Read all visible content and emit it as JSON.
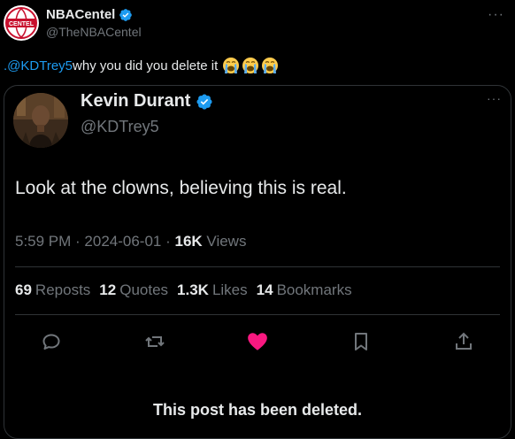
{
  "outer_tweet": {
    "author_name": "NBACentel",
    "author_handle": "@TheNBACentel",
    "avatar_text": "CENTEL",
    "mention": ".@KDTrey5",
    "text": " why you did you delete it",
    "emojis": [
      "loudly-crying-face",
      "loudly-crying-face",
      "loudly-crying-face"
    ],
    "more_label": "···"
  },
  "quoted_tweet": {
    "author_name": "Kevin Durant",
    "author_handle": "@KDTrey5",
    "more_label": "···",
    "text": "Look at the clowns, believing this is real.",
    "time": "5:59 PM",
    "separator": " · ",
    "date": "2024-06-01",
    "views_count": "16K",
    "views_label": " Views",
    "stats": {
      "reposts_count": "69",
      "reposts_label": "Reposts",
      "quotes_count": "12",
      "quotes_label": "Quotes",
      "likes_count": "1.3K",
      "likes_label": "Likes",
      "bookmarks_count": "14",
      "bookmarks_label": "Bookmarks"
    },
    "actions": [
      "reply-icon",
      "repost-icon",
      "like-icon",
      "bookmark-icon",
      "share-icon"
    ],
    "deleted_notice": "This post has been deleted."
  },
  "colors": {
    "background": "#000000",
    "text": "#e7e9ea",
    "secondary": "#71767b",
    "accent": "#1d9bf0",
    "like": "#f91880",
    "border": "#2f3336"
  }
}
